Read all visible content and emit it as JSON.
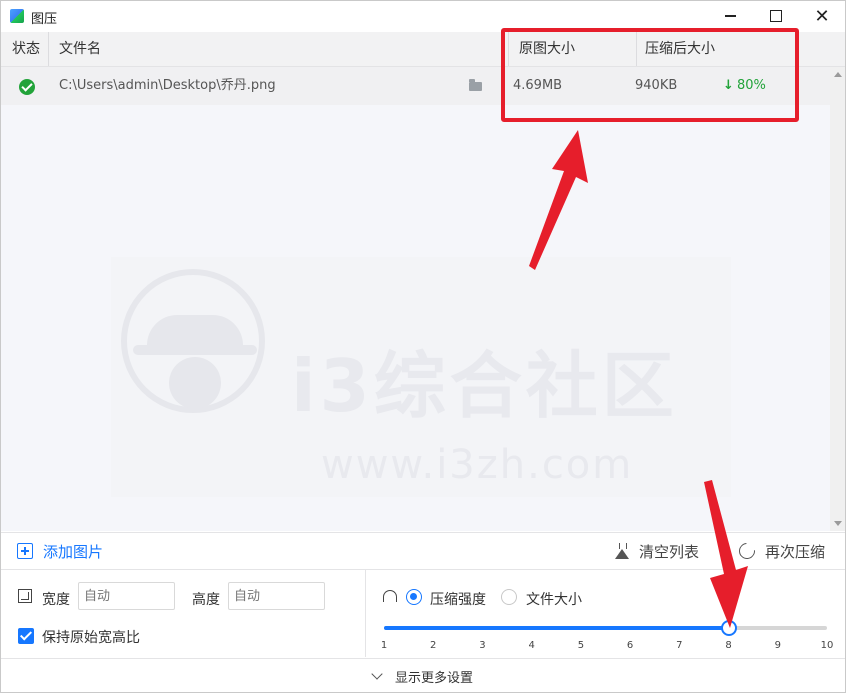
{
  "app": {
    "title": "图压"
  },
  "table": {
    "headers": {
      "status": "状态",
      "filename": "文件名",
      "original_size": "原图大小",
      "compressed_size": "压缩后大小"
    },
    "rows": [
      {
        "status": "done",
        "path": "C:\\Users\\admin\\Desktop\\乔丹.png",
        "original_size": "4.69MB",
        "compressed_size": "940KB",
        "ratio": "80%"
      }
    ]
  },
  "watermark": {
    "title": "i3综合社区",
    "url": "www.i3zh.com"
  },
  "toolbar": {
    "add": "添加图片",
    "clear": "清空列表",
    "recompress": "再次压缩"
  },
  "settings": {
    "width_label": "宽度",
    "width_placeholder": "自动",
    "height_label": "高度",
    "height_placeholder": "自动",
    "keep_ratio_label": "保持原始宽高比",
    "keep_ratio_checked": true,
    "mode_strength_label": "压缩强度",
    "mode_size_label": "文件大小",
    "selected_mode": "strength",
    "strength_value": 8,
    "strength_min": 1,
    "strength_max": 10,
    "ticks": [
      "1",
      "2",
      "3",
      "4",
      "5",
      "6",
      "7",
      "8",
      "9",
      "10"
    ]
  },
  "footer": {
    "more_label": "显示更多设置"
  },
  "colors": {
    "accent": "#1677ff",
    "success": "#22a33a",
    "annotation": "#e61e2b"
  }
}
